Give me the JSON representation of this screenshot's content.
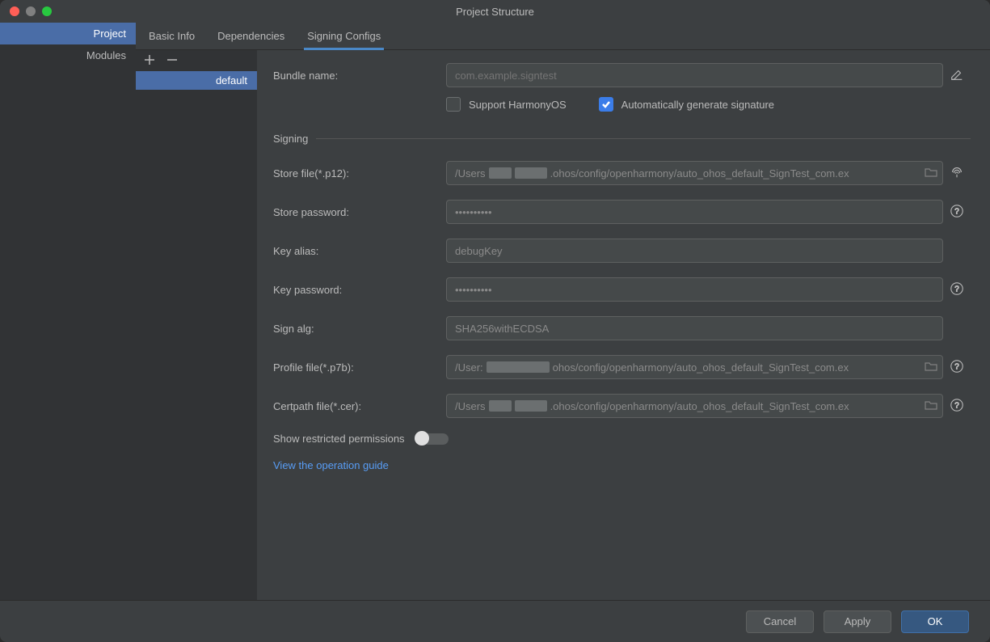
{
  "window": {
    "title": "Project Structure"
  },
  "sidebar": {
    "items": [
      {
        "label": "Project",
        "selected": true
      },
      {
        "label": "Modules",
        "selected": false
      }
    ]
  },
  "tabs": [
    {
      "label": "Basic Info",
      "selected": false
    },
    {
      "label": "Dependencies",
      "selected": false
    },
    {
      "label": "Signing Configs",
      "selected": true
    }
  ],
  "config_list": {
    "items": [
      {
        "label": "default",
        "selected": true
      }
    ]
  },
  "form": {
    "bundle_name": {
      "label": "Bundle name:",
      "placeholder": "com.example.signtest"
    },
    "support_harmony": {
      "label": "Support HarmonyOS",
      "checked": false
    },
    "auto_generate": {
      "label": "Automatically generate signature",
      "checked": true
    },
    "signing_section": "Signing",
    "store_file": {
      "label": "Store file(*.p12):",
      "parts": [
        "/Users",
        "",
        "",
        ".ohos/config/openharmony/auto_ohos_default_SignTest_com.ex"
      ]
    },
    "store_password": {
      "label": "Store password:",
      "value": "••••••••••"
    },
    "key_alias": {
      "label": "Key alias:",
      "value": "debugKey"
    },
    "key_password": {
      "label": "Key password:",
      "value": "••••••••••"
    },
    "sign_alg": {
      "label": "Sign alg:",
      "value": "SHA256withECDSA"
    },
    "profile_file": {
      "label": "Profile file(*.p7b):",
      "parts": [
        "/User:",
        "",
        "ohos/config/openharmony/auto_ohos_default_SignTest_com.ex"
      ]
    },
    "certpath_file": {
      "label": "Certpath file(*.cer):",
      "parts": [
        "/Users",
        "",
        "",
        ".ohos/config/openharmony/auto_ohos_default_SignTest_com.ex"
      ]
    },
    "restricted": {
      "label": "Show restricted permissions",
      "checked": false
    },
    "guide_link": "View the operation guide"
  },
  "footer": {
    "cancel": "Cancel",
    "apply": "Apply",
    "ok": "OK"
  }
}
